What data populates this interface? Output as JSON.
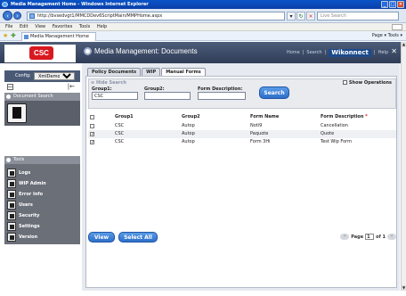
{
  "window": {
    "title": "Media Management Home - Windows Internet Explorer"
  },
  "browser": {
    "url": "http://bvsedvgt1/MMCDDev6ScriptMain/MMPHome.aspx",
    "search_placeholder": "Live Search",
    "menu": [
      "File",
      "Edit",
      "View",
      "Favorites",
      "Tools",
      "Help"
    ],
    "tab_title": "Media Management Home",
    "tools_label": "Page ▾  Tools ▾"
  },
  "app": {
    "logo": "CSC",
    "title": "Media Management: Documents",
    "links": {
      "home": "Home",
      "sep1": "|",
      "search": "Search",
      "sep2": "|",
      "brand": "Wikonnect",
      "sep3": "|",
      "help": "Help"
    }
  },
  "sidebar": {
    "config_label": "Config:",
    "config_value": "XmlDemo",
    "document_search_label": "Document Search",
    "tools_label": "Tools",
    "tools": [
      "Logs",
      "WIP Admin",
      "Error Info",
      "Users",
      "Security",
      "Settings",
      "Version"
    ]
  },
  "tabs": [
    "Policy Documents",
    "WIP",
    "Manual Forms"
  ],
  "active_tab": "Manual Forms",
  "search": {
    "hide_label": "Hide Search",
    "show_operations_label": "Show Operations",
    "group1_label": "Group1:",
    "group1_value": "CSC",
    "group2_label": "Group2:",
    "group2_value": "",
    "form_desc_label": "Form Description:",
    "form_desc_value": "",
    "button": "Search"
  },
  "table": {
    "headers": [
      "Group1",
      "Group2",
      "Form Name",
      "Form Description"
    ],
    "required_marker": "*",
    "rows": [
      {
        "checked": false,
        "group1": "CSC",
        "group2": "Autop",
        "form_name": "Noti9",
        "form_desc": "Cancellation"
      },
      {
        "checked": true,
        "group1": "CSC",
        "group2": "Autop",
        "form_name": "Paquote",
        "form_desc": "Quote"
      },
      {
        "checked": true,
        "group1": "CSC",
        "group2": "Autop",
        "form_name": "Form 3Hi",
        "form_desc": "Test Wip Form"
      }
    ]
  },
  "actions": {
    "view": "View",
    "select_all": "Select All"
  },
  "pager": {
    "page_label": "Page",
    "page_value": "1",
    "of_label": "of 1"
  }
}
